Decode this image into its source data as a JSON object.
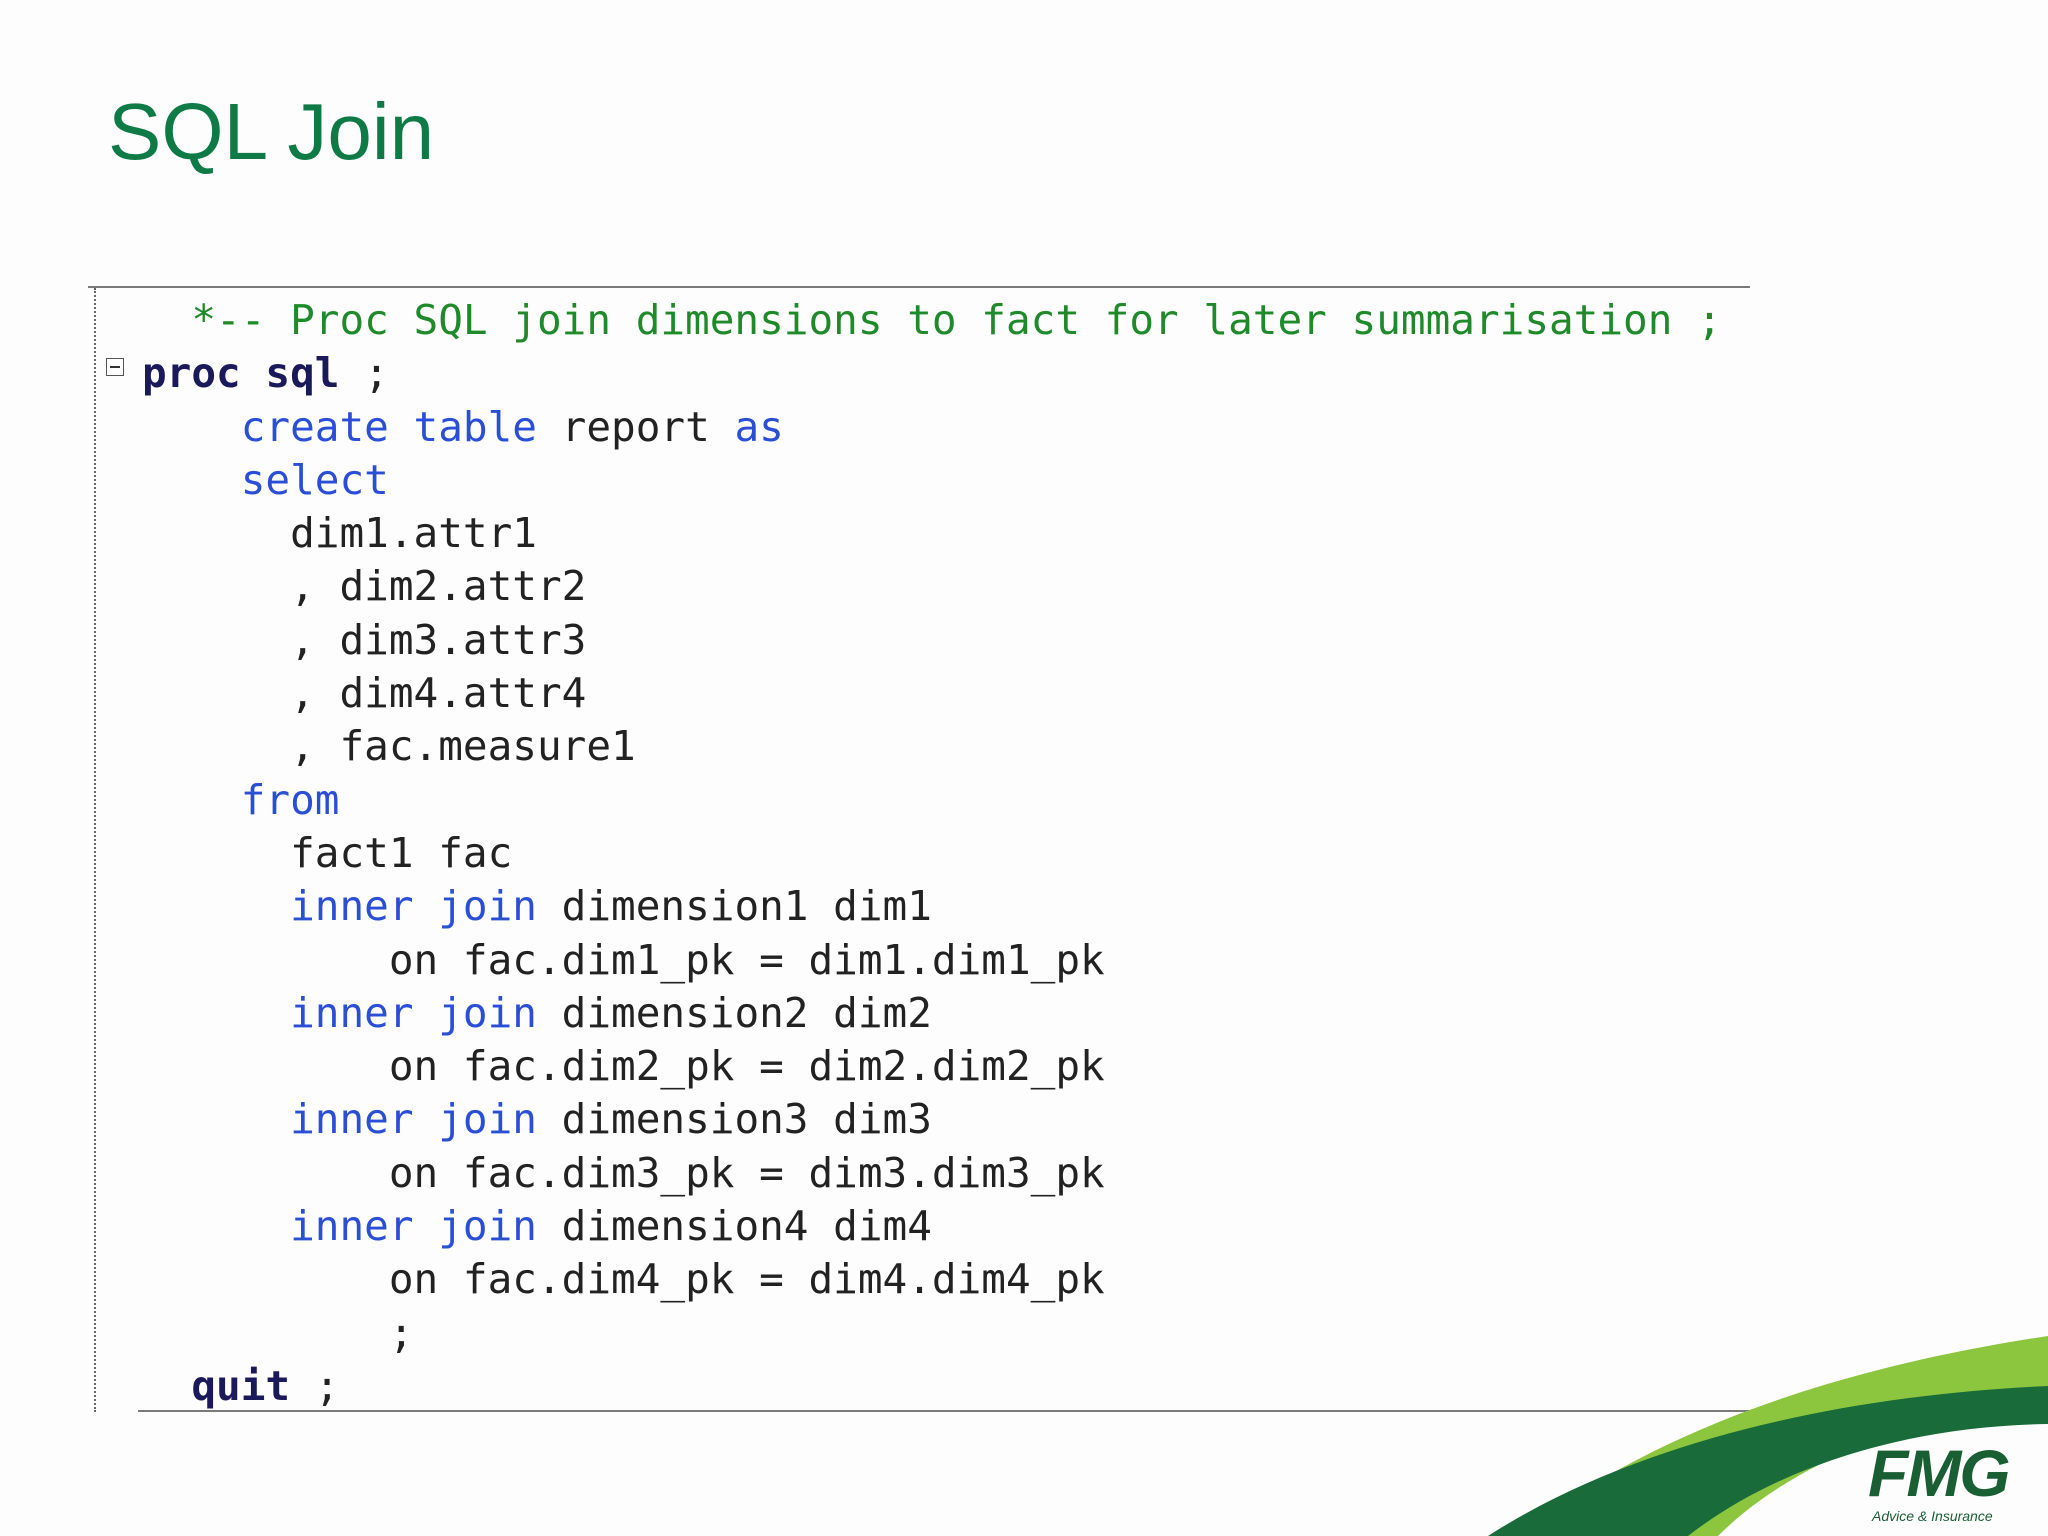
{
  "slide": {
    "title": "SQL Join"
  },
  "code": {
    "comment": "*-- Proc SQL join dimensions to fact for later summarisation ;",
    "proc": "proc sql",
    "proc_end": " ;",
    "indent2": "  ",
    "indent4": "    ",
    "indent8": "        ",
    "create": "create table",
    "report": " report ",
    "as": "as",
    "select": "select",
    "sel_first": "dim1.attr1",
    "sel_rest": [
      ", dim2.attr2",
      ", dim3.attr3",
      ", dim4.attr4",
      ", fac.measure1"
    ],
    "from": "from",
    "fact": "fact1 fac",
    "inner_join": "inner join",
    "joins": [
      {
        "table": " dimension1 dim1",
        "on": "on fac.dim1_pk = dim1.dim1_pk"
      },
      {
        "table": " dimension2 dim2",
        "on": "on fac.dim2_pk = dim2.dim2_pk"
      },
      {
        "table": " dimension3 dim3",
        "on": "on fac.dim3_pk = dim3.dim3_pk"
      },
      {
        "table": " dimension4 dim4",
        "on": "on fac.dim4_pk = dim4.dim4_pk"
      }
    ],
    "semicolon": ";",
    "quit": "quit",
    "quit_end": " ;"
  },
  "logo": {
    "name": "FMG",
    "tagline": "Advice & Insurance",
    "colors": {
      "light_green": "#8cc63f",
      "dark_green": "#1a6b3a",
      "title_green": "#0e7a45"
    }
  }
}
